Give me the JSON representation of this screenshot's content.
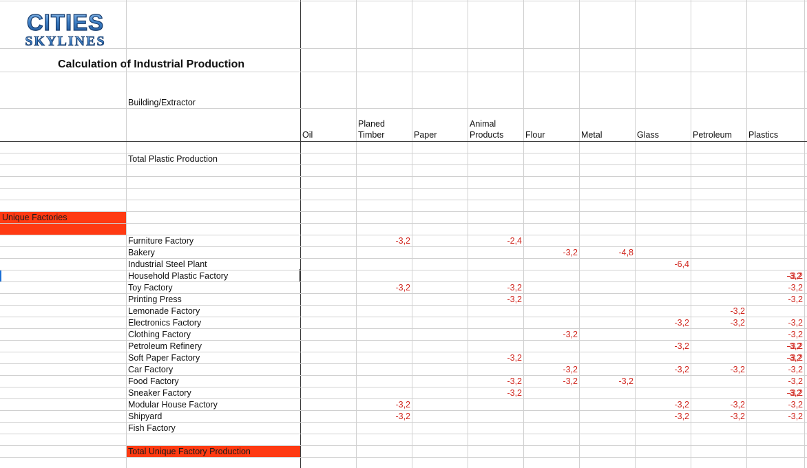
{
  "header": {
    "logo_text": "CITIES SKYLINES",
    "title": "Calculation of Industrial Production",
    "building_label": "Building/Extractor",
    "total_plastic_label": "Total Plastic Production"
  },
  "columns": [
    {
      "key": "oil",
      "line1": "",
      "line2": "Oil"
    },
    {
      "key": "planed_timber",
      "line1": "Planed",
      "line2": "Timber"
    },
    {
      "key": "paper",
      "line1": "",
      "line2": "Paper"
    },
    {
      "key": "animal_products",
      "line1": "Animal",
      "line2": "Products"
    },
    {
      "key": "flour",
      "line1": "",
      "line2": "Flour"
    },
    {
      "key": "metal",
      "line1": "",
      "line2": "Metal"
    },
    {
      "key": "glass",
      "line1": "",
      "line2": "Glass"
    },
    {
      "key": "petroleum",
      "line1": "",
      "line2": "Petroleum"
    },
    {
      "key": "plastics",
      "line1": "",
      "line2": "Plastics"
    }
  ],
  "section": {
    "label": "Unique Factories",
    "fill_color": "#ff3a12",
    "total_label": "Total Unique Factory Production"
  },
  "factories": [
    {
      "name": "Furniture Factory",
      "values": {
        "planed_timber": "-3,2",
        "animal_products": "-2,4"
      }
    },
    {
      "name": "Bakery",
      "values": {
        "flour": "-3,2",
        "metal": "-4,8"
      }
    },
    {
      "name": "Industrial Steel Plant",
      "values": {
        "glass": "-6,4"
      }
    },
    {
      "name": "Household Plastic Factory",
      "values": {
        "plastics": "-3,2",
        "extra": "-3,2"
      }
    },
    {
      "name": "Toy Factory",
      "values": {
        "planed_timber": "-3,2",
        "animal_products": "-3,2",
        "extra": "-3,2"
      }
    },
    {
      "name": "Printing Press",
      "values": {
        "animal_products": "-3,2",
        "extra": "-3,2"
      }
    },
    {
      "name": "Lemonade Factory",
      "values": {
        "petroleum": "-3,2"
      }
    },
    {
      "name": "Electronics Factory",
      "values": {
        "glass": "-3,2",
        "petroleum": "-3,2",
        "extra": "-3,2"
      }
    },
    {
      "name": "Clothing Factory",
      "values": {
        "flour": "-3,2",
        "extra": "-3,2"
      }
    },
    {
      "name": "Petroleum Refinery",
      "values": {
        "glass": "-3,2",
        "plastics": "-3,2",
        "extra": "-3,2"
      }
    },
    {
      "name": "Soft Paper Factory",
      "values": {
        "animal_products": "-3,2",
        "plastics": "-3,2",
        "extra": "-3,2"
      }
    },
    {
      "name": "Car Factory",
      "values": {
        "flour": "-3,2",
        "glass": "-3,2",
        "petroleum": "-3,2",
        "extra": "-3,2"
      }
    },
    {
      "name": "Food Factory",
      "values": {
        "animal_products": "-3,2",
        "flour": "-3,2",
        "metal": "-3,2",
        "extra": "-3,2"
      }
    },
    {
      "name": "Sneaker Factory",
      "values": {
        "animal_products": "-3,2",
        "plastics": "-3,2",
        "extra": "-3,2"
      }
    },
    {
      "name": "Modular House Factory",
      "values": {
        "planed_timber": "-3,2",
        "glass": "-3,2",
        "petroleum": "-3,2",
        "extra": "-3,2"
      }
    },
    {
      "name": "Shipyard",
      "values": {
        "planed_timber": "-3,2",
        "glass": "-3,2",
        "petroleum": "-3,2",
        "extra": "-3,2"
      }
    },
    {
      "name": "Fish Factory",
      "values": {}
    }
  ]
}
